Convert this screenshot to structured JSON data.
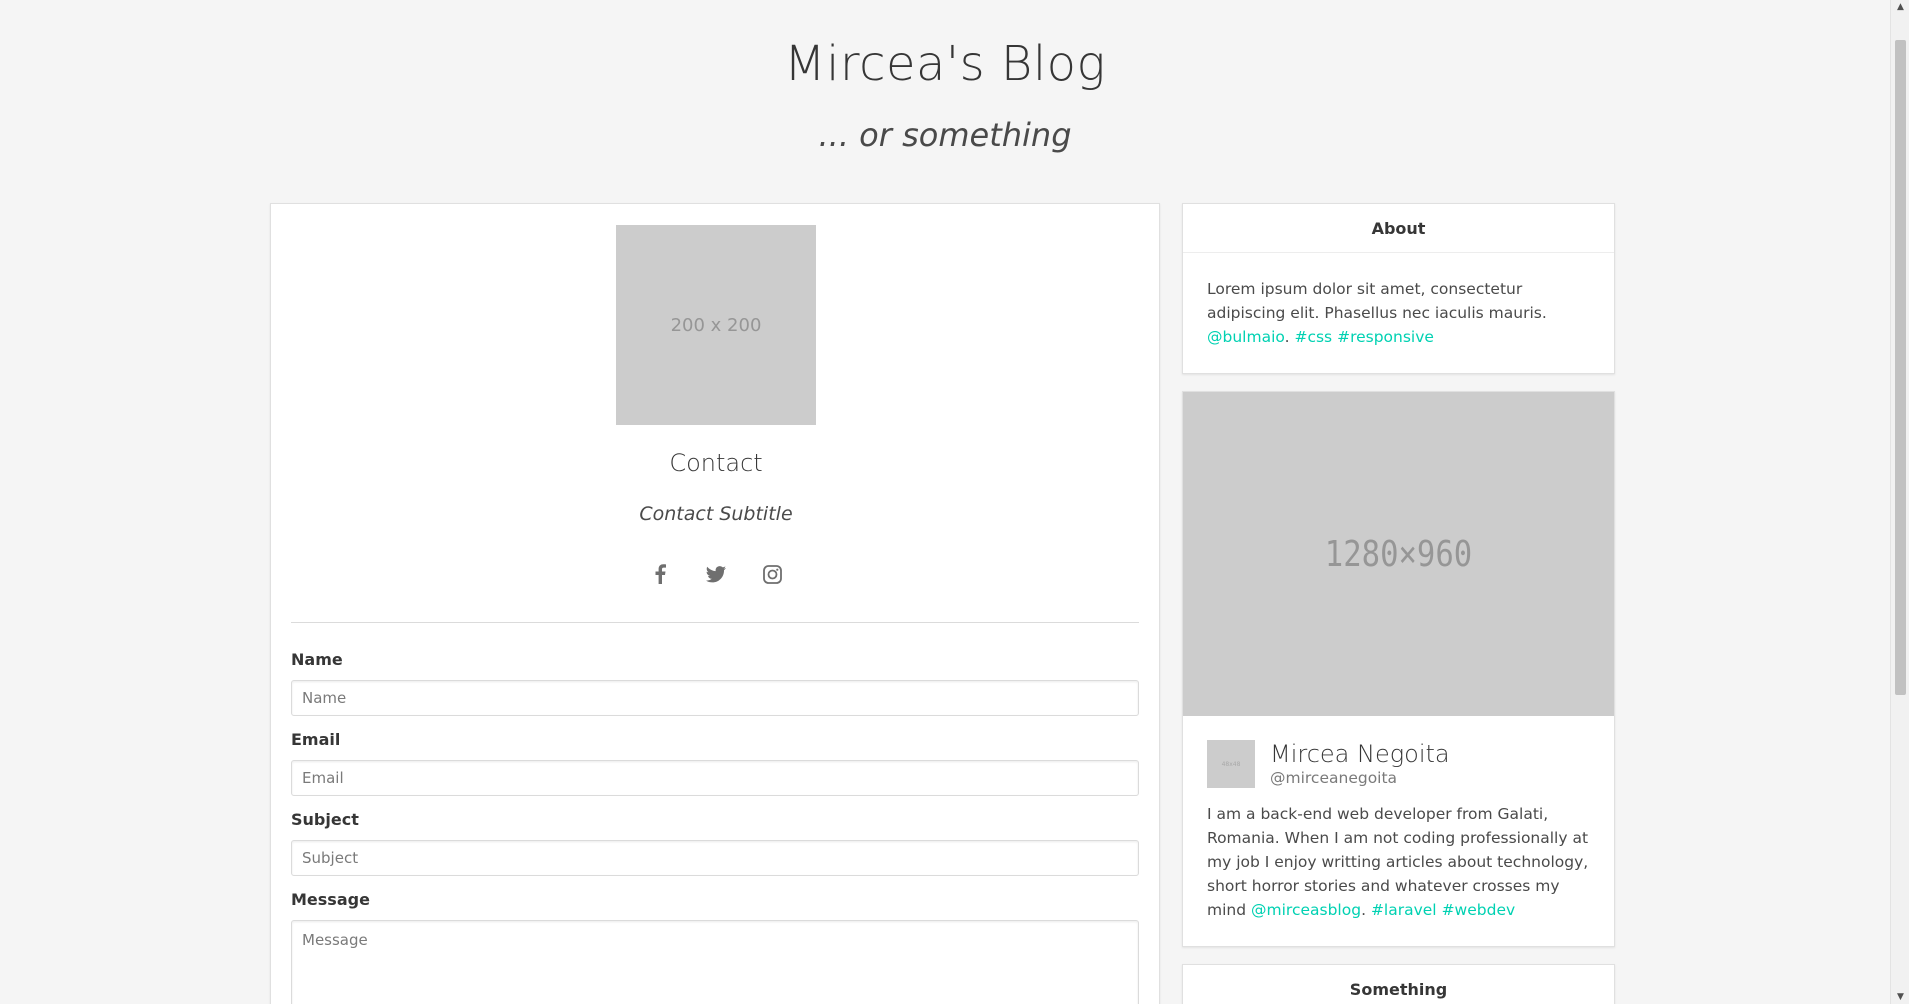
{
  "header": {
    "title": "Mircea's Blog",
    "subtitle": "... or something"
  },
  "contact": {
    "image_label": "200 x 200",
    "title": "Contact",
    "subtitle": "Contact Subtitle",
    "social_icons": [
      "facebook-icon",
      "twitter-icon",
      "instagram-icon"
    ],
    "form": {
      "name_label": "Name",
      "name_placeholder": "Name",
      "email_label": "Email",
      "email_placeholder": "Email",
      "subject_label": "Subject",
      "subject_placeholder": "Subject",
      "message_label": "Message",
      "message_placeholder": "Message"
    }
  },
  "sidebar": {
    "about": {
      "title": "About",
      "text": "Lorem ipsum dolor sit amet, consectetur adipiscing elit. Phasellus nec iaculis mauris.",
      "link_1": "@bulmaio",
      "separator": ".",
      "link_2": "#css",
      "link_3": "#responsive"
    },
    "profile": {
      "image_label": "1280×960",
      "avatar_label": "48x48",
      "name": "Mircea Negoita",
      "handle": "@mirceanegoita",
      "bio": "I am a back-end web developer from Galati, Romania. When I am not coding professionally at my job I enjoy writting articles about technology, short horror stories and whatever crosses my mind",
      "link_1": "@mirceasblog",
      "separator": ".",
      "link_2": "#laravel",
      "link_3": "#webdev"
    },
    "something": {
      "title": "Something"
    }
  },
  "colors": {
    "background": "#f5f5f5",
    "link": "#00d1b2",
    "placeholder_fill": "#cccccc"
  }
}
